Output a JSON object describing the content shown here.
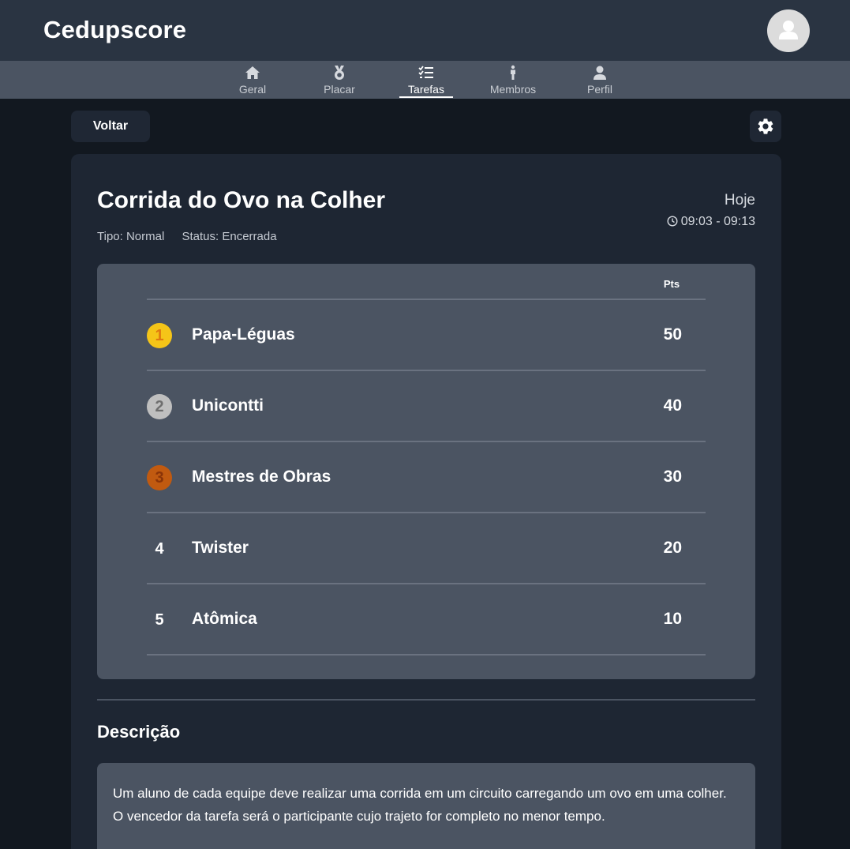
{
  "app": {
    "title": "Cedupscore"
  },
  "nav": {
    "items": [
      {
        "label": "Geral",
        "icon": "home-icon"
      },
      {
        "label": "Placar",
        "icon": "medal-icon"
      },
      {
        "label": "Tarefas",
        "icon": "checklist-icon",
        "active": true
      },
      {
        "label": "Membros",
        "icon": "person-icon"
      },
      {
        "label": "Perfil",
        "icon": "user-icon"
      }
    ]
  },
  "actions": {
    "back_label": "Voltar",
    "settings_icon": "gear-icon"
  },
  "task": {
    "title": "Corrida do Ovo na Colher",
    "type": "Tipo: Normal",
    "status": "Status: Encerrada",
    "day": "Hoje",
    "time": "09:03 - 09:13"
  },
  "scores": {
    "points_header": "Pts",
    "rows": [
      {
        "rank": "1",
        "team": "Papa-Léguas",
        "points": "50"
      },
      {
        "rank": "2",
        "team": "Unicontti",
        "points": "40"
      },
      {
        "rank": "3",
        "team": "Mestres de Obras",
        "points": "30"
      },
      {
        "rank": "4",
        "team": "Twister",
        "points": "20"
      },
      {
        "rank": "5",
        "team": "Atômica",
        "points": "10"
      }
    ]
  },
  "description": {
    "title": "Descrição",
    "text": "Um aluno de cada equipe deve realizar uma corrida em um circuito carregando um ovo em uma colher. O vencedor da tarefa será o participante cujo trajeto for completo no menor tempo."
  },
  "colors": {
    "gold": "#f5c518",
    "silver": "#bfbfbf",
    "bronze": "#c15a10",
    "header_bg": "#2a3442",
    "nav_bg": "#4b5462"
  }
}
